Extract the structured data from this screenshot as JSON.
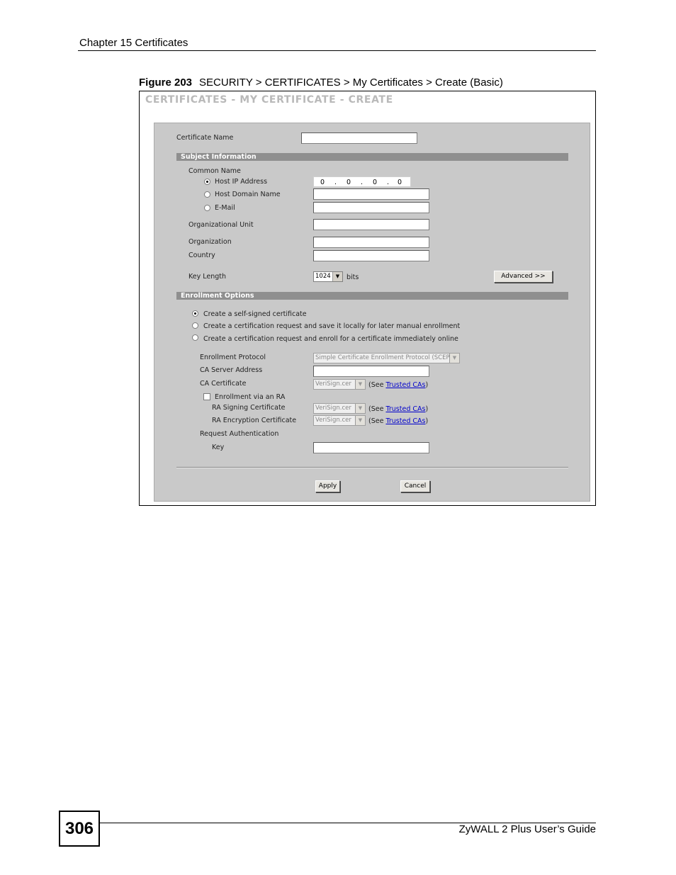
{
  "page_header": "Chapter 15 Certificates",
  "figure": {
    "number": "Figure 203",
    "caption": "SECURITY > CERTIFICATES > My Certificates > Create (Basic)"
  },
  "screen": {
    "title": "CERTIFICATES - MY CERTIFICATE - CREATE",
    "certificate_name_label": "Certificate Name",
    "subject_section": "Subject Information",
    "common_name_label": "Common Name",
    "host_ip_label": "Host IP Address",
    "host_ip": [
      "0",
      "0",
      "0",
      "0"
    ],
    "host_domain_label": "Host Domain Name",
    "email_label": "E-Mail",
    "org_unit_label": "Organizational Unit",
    "organization_label": "Organization",
    "country_label": "Country",
    "key_length_label": "Key Length",
    "key_length_value": "1024",
    "bits_label": "bits",
    "advanced_button": "Advanced >>",
    "enrollment_section": "Enrollment Options",
    "opt_self_signed": "Create a self-signed certificate",
    "opt_request_local": "Create a certification request and save it locally for later manual enrollment",
    "opt_request_online": "Create a certification request and enroll for a certificate immediately online",
    "enrollment_protocol_label": "Enrollment Protocol",
    "enrollment_protocol_value": "Simple Certificate Enrollment Protocol (SCEP)",
    "ca_server_label": "CA Server Address",
    "ca_cert_label": "CA Certificate",
    "ca_cert_value": "VeriSign.cer",
    "see_open": "(See",
    "trusted_link": "Trusted CAs",
    "see_close": ")",
    "enroll_ra_label": "Enrollment via an RA",
    "ra_signing_label": "RA Signing Certificate",
    "ra_signing_value": "VeriSign.cer",
    "ra_encryption_label": "RA Encryption Certificate",
    "ra_encryption_value": "VeriSign.cer",
    "request_auth_label": "Request Authentication",
    "key_label": "Key",
    "apply_button": "Apply",
    "cancel_button": "Cancel"
  },
  "footer": {
    "page_number": "306",
    "guide_title": "ZyWALL 2 Plus User’s Guide"
  }
}
